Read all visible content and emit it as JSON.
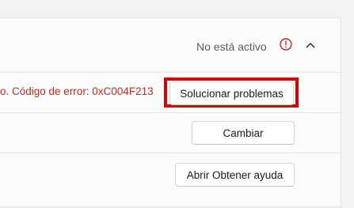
{
  "activation": {
    "status_text": "No está activo",
    "info_icon": "info-circle-icon",
    "chevron_icon": "chevron-up-icon",
    "error_text": "o. Código de error: 0xC004F213",
    "error_color": "#c42b1c",
    "highlight_color": "#d90000"
  },
  "actions": {
    "troubleshoot_label": "Solucionar problemas",
    "change_label": "Cambiar",
    "help_label": "Abrir Obtener ayuda"
  }
}
